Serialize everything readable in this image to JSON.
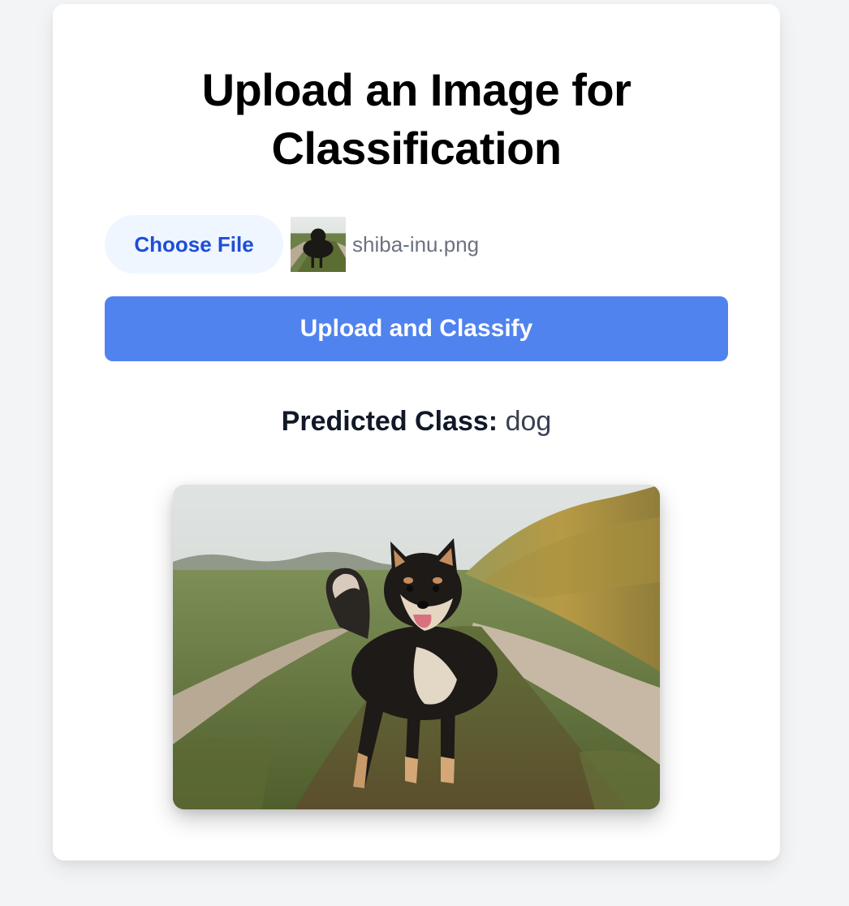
{
  "page": {
    "title_line1": "Upload an Image for",
    "title_line2": "Classification"
  },
  "file_input": {
    "button_label": "Choose File",
    "selected_file": "shiba-inu.png"
  },
  "actions": {
    "upload_label": "Upload and Classify"
  },
  "result": {
    "label": "Predicted Class:",
    "value": "dog"
  },
  "colors": {
    "background": "#f3f4f6",
    "card": "#ffffff",
    "primary_button": "#5083ee",
    "file_button_bg": "#eff6ff",
    "file_button_text": "#1d4ed8"
  }
}
